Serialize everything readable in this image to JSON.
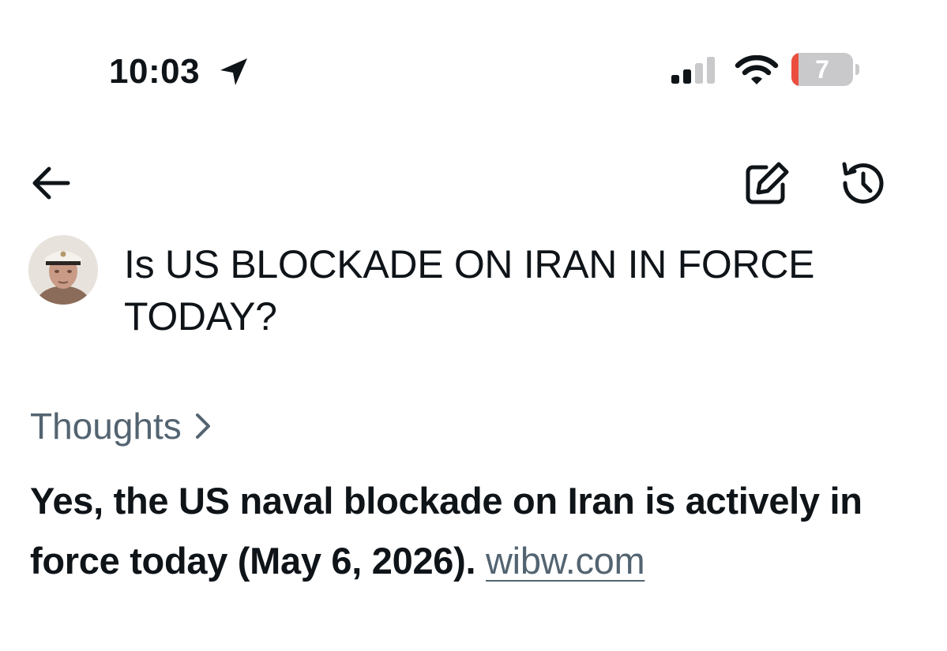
{
  "status_bar": {
    "time": "10:03",
    "battery_level": "7",
    "battery_fraction": 0.07,
    "icons": [
      "location-arrow-icon",
      "cellular-signal-icon",
      "wifi-icon",
      "battery-icon"
    ]
  },
  "nav": {
    "icons": [
      "arrow-left-icon",
      "edit-icon",
      "history-icon"
    ]
  },
  "query": {
    "text": "Is US BLOCKADE ON IRAN IN FORCE TODAY?"
  },
  "thoughts": {
    "label": "Thoughts",
    "chevron_icon": "chevron-right-icon"
  },
  "answer": {
    "text": "Yes, the US naval blockade on Iran is actively in force today (May 6, 2026).",
    "source": "wibw.com"
  },
  "colors": {
    "text_primary": "#0f1419",
    "text_secondary": "#536471",
    "battery_low": "#eb4e3d",
    "battery_track": "#c9c9cb"
  }
}
